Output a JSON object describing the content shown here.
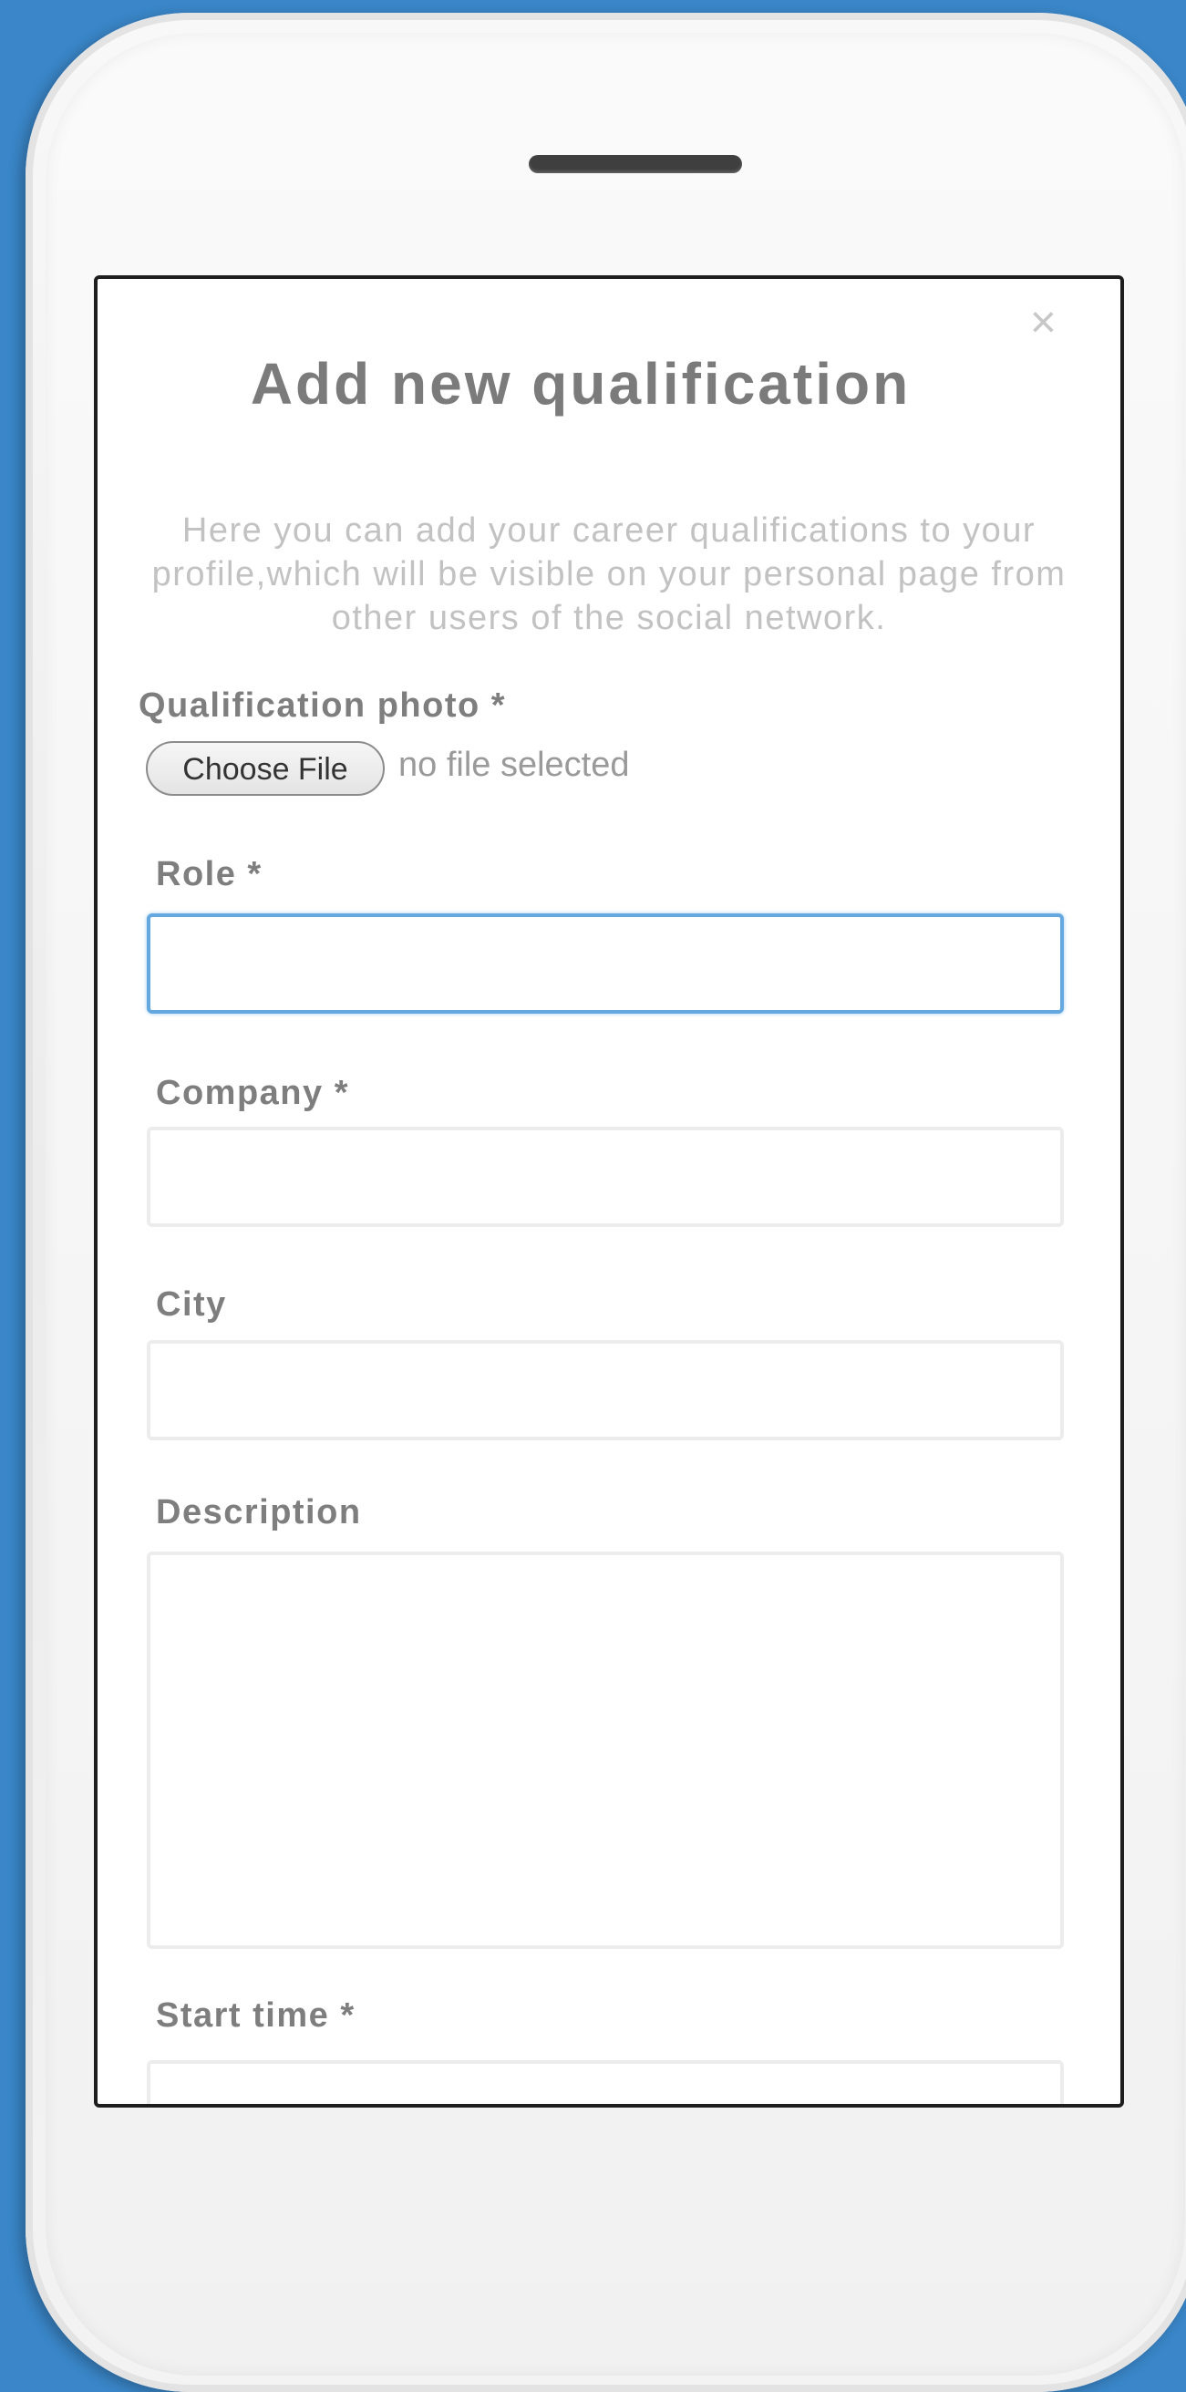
{
  "modal": {
    "title": "Add new qualification",
    "close_glyph": "×",
    "intro": "Here you can add your career qualifications to your profile,which will be visible on your personal page from other users of the social network."
  },
  "form": {
    "photo": {
      "label": "Qualification photo *",
      "button_label": "Choose File",
      "status": "no file selected"
    },
    "role": {
      "label": "Role *",
      "value": ""
    },
    "company": {
      "label": "Company *",
      "value": ""
    },
    "city": {
      "label": "City",
      "value": ""
    },
    "description": {
      "label": "Description",
      "value": ""
    },
    "start_time": {
      "label": "Start time *",
      "value": ""
    }
  },
  "colors": {
    "background": "#3a86c8",
    "focus_border": "#64a8df",
    "label_text": "#7e7e7e",
    "intro_text": "#c2c2c2"
  },
  "icons": {
    "close": "close-icon"
  }
}
